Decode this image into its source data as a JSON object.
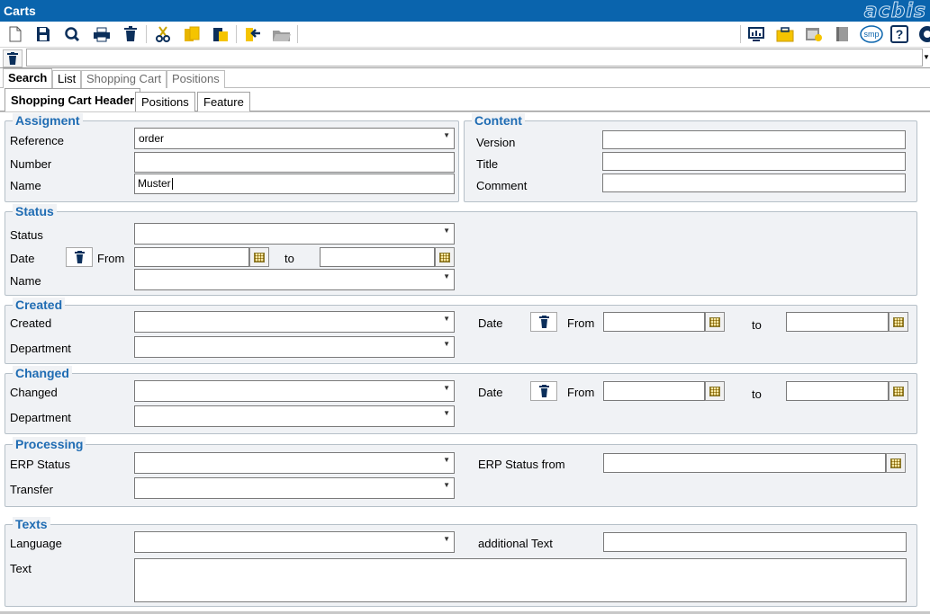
{
  "window": {
    "title": "Carts",
    "logo": "acbis"
  },
  "toolbar": {
    "left_icons": [
      "new-document-icon",
      "save-icon",
      "search-icon",
      "print-icon",
      "delete-icon",
      "cut-icon",
      "copy-icon",
      "paste-icon",
      "export-icon",
      "open-folder-icon"
    ],
    "right_icons": [
      "monitor-chart-icon",
      "briefcase-icon",
      "calendar-check-icon",
      "book-icon",
      "smp-icon",
      "help-icon",
      "exit-icon"
    ],
    "smp_label": "smp",
    "help_label": "?"
  },
  "tabs_main": [
    "Search",
    "List",
    "Shopping Cart",
    "Positions"
  ],
  "tabs_sub": [
    "Shopping Cart Header",
    "Positions",
    "Feature"
  ],
  "groups": {
    "assigment": {
      "title": "Assigment",
      "reference_label": "Reference",
      "reference_value": "order",
      "number_label": "Number",
      "number_value": "",
      "name_label": "Name",
      "name_value": "Muster"
    },
    "content": {
      "title": "Content",
      "version_label": "Version",
      "title_label": "Title",
      "comment_label": "Comment"
    },
    "status": {
      "title": "Status",
      "status_label": "Status",
      "date_label": "Date",
      "from_label": "From",
      "to_label": "to",
      "name_label": "Name"
    },
    "created": {
      "title": "Created",
      "created_label": "Created",
      "department_label": "Department",
      "date_label": "Date",
      "from_label": "From",
      "to_label": "to"
    },
    "changed": {
      "title": "Changed",
      "changed_label": "Changed",
      "department_label": "Department",
      "date_label": "Date",
      "from_label": "From",
      "to_label": "to"
    },
    "processing": {
      "title": "Processing",
      "erp_status_label": "ERP Status",
      "transfer_label": "Transfer",
      "erp_status_from_label": "ERP Status from"
    },
    "texts": {
      "title": "Texts",
      "language_label": "Language",
      "text_label": "Text",
      "additional_text_label": "additional Text"
    }
  },
  "colors": {
    "titlebar": "#0a64ad",
    "legend": "#1f6cb3",
    "group_bg": "#f0f2f5"
  }
}
